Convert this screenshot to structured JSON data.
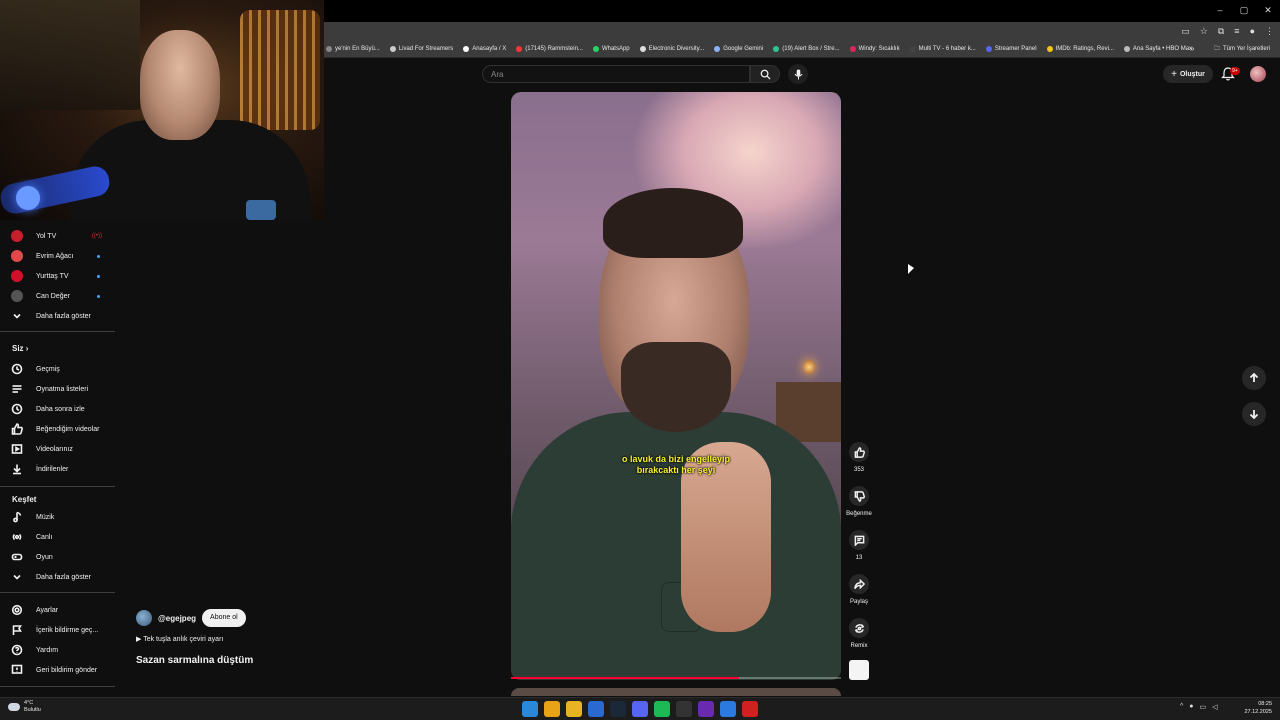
{
  "browser": {
    "window_controls": [
      "–",
      "▢",
      "✕"
    ],
    "bookmarks": [
      {
        "label": "ye'nin En Büyü...",
        "color": "#888888"
      },
      {
        "label": "Livad For Streamers",
        "color": "#cccccc"
      },
      {
        "label": "Anasayfa / X",
        "color": "#ffffff"
      },
      {
        "label": "(17145) Rammstein...",
        "color": "#ff3333"
      },
      {
        "label": "WhatsApp",
        "color": "#25d366"
      },
      {
        "label": "Electronic Diversity...",
        "color": "#dddddd"
      },
      {
        "label": "Google Gemini",
        "color": "#8ab4f8"
      },
      {
        "label": "(19) Alert Box / Stre...",
        "color": "#31c48d"
      },
      {
        "label": "Windy: Sıcaklık",
        "color": "#e0245e"
      },
      {
        "label": "Multi TV - 6 haber k...",
        "color": "#444444"
      },
      {
        "label": "Streamer Panel",
        "color": "#5865f2"
      },
      {
        "label": "IMDb: Ratings, Revi...",
        "color": "#f5c518"
      },
      {
        "label": "Ana Sayfa • HBO Max",
        "color": "#bbbbbb"
      }
    ],
    "bookmarks_more": "»",
    "all_bookmarks": "Tüm Yer İşaretleri"
  },
  "header": {
    "search_placeholder": "Ara",
    "create_label": "Oluştur",
    "notification_count": "9+"
  },
  "sidebar": {
    "subscriptions": [
      {
        "label": "Yol TV",
        "color": "#c81e2c",
        "indicator": "live"
      },
      {
        "label": "Evrim Ağacı",
        "color": "#e04a4a",
        "indicator": "new"
      },
      {
        "label": "Yurttaş TV",
        "color": "#d0102a",
        "indicator": "new"
      },
      {
        "label": "Can Değer",
        "color": "#555555",
        "indicator": "new"
      }
    ],
    "show_more_subs": "Daha fazla göster",
    "you_heading": "Siz",
    "you_items": [
      {
        "label": "Geçmiş",
        "icon": "history-icon"
      },
      {
        "label": "Oynatma listeleri",
        "icon": "playlists-icon"
      },
      {
        "label": "Daha sonra izle",
        "icon": "watch-later-icon"
      },
      {
        "label": "Beğendiğim videolar",
        "icon": "liked-icon"
      },
      {
        "label": "Videolarınız",
        "icon": "your-videos-icon"
      },
      {
        "label": "İndirilenler",
        "icon": "downloads-icon"
      }
    ],
    "explore_heading": "Keşfet",
    "explore_items": [
      {
        "label": "Müzik",
        "icon": "music-icon"
      },
      {
        "label": "Canlı",
        "icon": "live-icon"
      },
      {
        "label": "Oyun",
        "icon": "gaming-icon"
      }
    ],
    "show_more_explore": "Daha fazla göster",
    "bottom_items": [
      {
        "label": "Ayarlar",
        "icon": "settings-icon"
      },
      {
        "label": "İçerik bildirme geç...",
        "icon": "flag-icon"
      },
      {
        "label": "Yardım",
        "icon": "help-icon"
      },
      {
        "label": "Geri bildirim gönder",
        "icon": "feedback-icon"
      }
    ]
  },
  "short": {
    "caption_line1": "o lavuk da bizi engelleyip",
    "caption_line2": "bırakcaktı her şeyi",
    "channel": "@egejpeg",
    "subscribe_label": "Abone ol",
    "translate_label": "▶ Tek tuşla anlık çeviri ayarı",
    "title": "Sazan sarmalına düştüm",
    "progress": 0.69,
    "actions": {
      "like_count": "353",
      "dislike_label": "Beğenme",
      "comment_count": "13",
      "share_label": "Paylaş",
      "remix_label": "Remix"
    }
  },
  "taskbar": {
    "temperature": "4°C",
    "weather": "Bulutlu",
    "time": "08:25",
    "date": "27.12.2025",
    "apps": [
      {
        "name": "start",
        "color": "#2b88d8"
      },
      {
        "name": "chrome",
        "color": "#e8a317"
      },
      {
        "name": "explorer",
        "color": "#e6b422"
      },
      {
        "name": "app-blue",
        "color": "#2a6ad0"
      },
      {
        "name": "steam",
        "color": "#1b2838"
      },
      {
        "name": "discord",
        "color": "#5865f2"
      },
      {
        "name": "spotify",
        "color": "#1db954"
      },
      {
        "name": "calculator",
        "color": "#333333"
      },
      {
        "name": "kick",
        "color": "#6a2ab0"
      },
      {
        "name": "app-blue-2",
        "color": "#2a7ae0"
      },
      {
        "name": "recorder",
        "color": "#d02020"
      }
    ]
  }
}
